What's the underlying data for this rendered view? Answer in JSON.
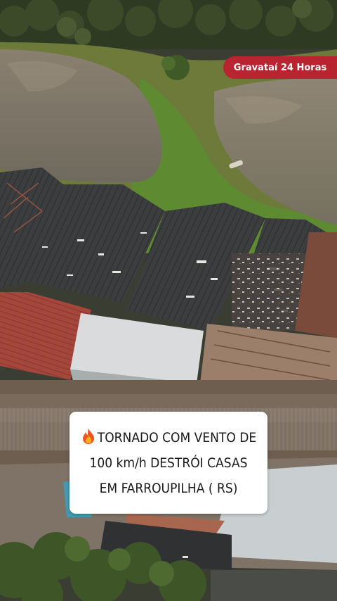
{
  "watermark": {
    "label": "Gravataí 24 Horas",
    "color": "#b8242f"
  },
  "caption": {
    "icon": "fire-emoji",
    "lines": [
      "TORNADO COM VENTO DE",
      "100 km/h DESTRÓI CASAS",
      "EM FARROUPILHA ( RS)"
    ]
  }
}
